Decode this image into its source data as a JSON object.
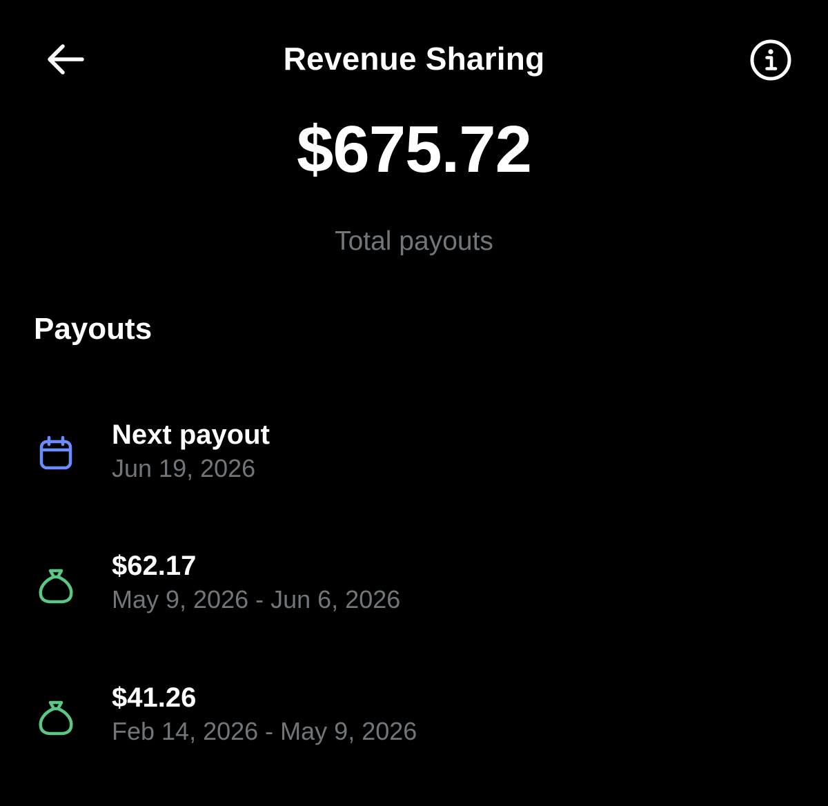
{
  "header": {
    "title": "Revenue Sharing",
    "back_icon": "arrow-left-icon",
    "info_icon": "info-circle-icon"
  },
  "summary": {
    "total_amount": "$675.72",
    "total_label": "Total payouts"
  },
  "payouts_section": {
    "title": "Payouts",
    "items": [
      {
        "icon": "calendar-icon",
        "icon_color": "#6a8cff",
        "primary": "Next payout",
        "secondary": "Jun 19, 2026"
      },
      {
        "icon": "money-bag-icon",
        "icon_color": "#5ac882",
        "primary": "$62.17",
        "secondary": "May 9, 2026 - Jun 6, 2026"
      },
      {
        "icon": "money-bag-icon",
        "icon_color": "#5ac882",
        "primary": "$41.26",
        "secondary": "Feb 14, 2026 - May 9, 2026"
      }
    ]
  },
  "colors": {
    "background": "#000000",
    "primary_text": "#ffffff",
    "secondary_text": "#71767b"
  }
}
